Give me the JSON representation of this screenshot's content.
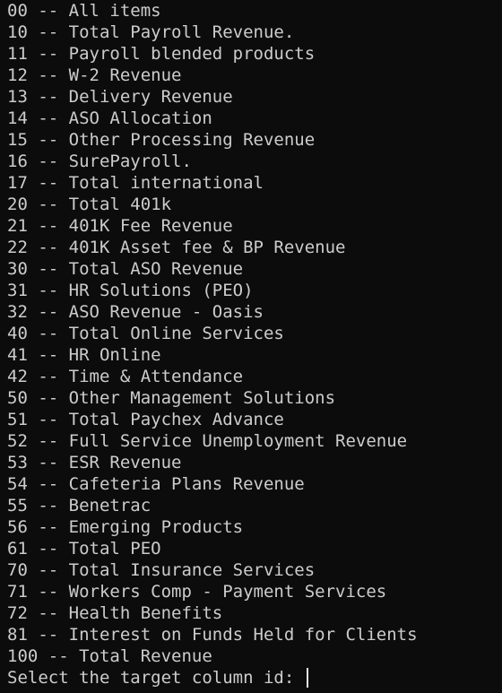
{
  "lines": [
    "00 -- All items",
    "10 -- Total Payroll Revenue.",
    "11 -- Payroll blended products",
    "12 -- W-2 Revenue",
    "13 -- Delivery Revenue",
    "14 -- ASO Allocation",
    "15 -- Other Processing Revenue",
    "16 -- SurePayroll.",
    "17 -- Total international",
    "20 -- Total 401k",
    "21 -- 401K Fee Revenue",
    "22 -- 401K Asset fee & BP Revenue",
    "30 -- Total ASO Revenue",
    "31 -- HR Solutions (PEO)",
    "32 -- ASO Revenue - Oasis",
    "40 -- Total Online Services",
    "41 -- HR Online",
    "42 -- Time & Attendance",
    "50 -- Other Management Solutions",
    "51 -- Total Paychex Advance",
    "52 -- Full Service Unemployment Revenue",
    "53 -- ESR Revenue",
    "54 -- Cafeteria Plans Revenue",
    "55 -- Benetrac",
    "56 -- Emerging Products",
    "61 -- Total PEO",
    "70 -- Total Insurance Services",
    "71 -- Workers Comp - Payment Services",
    "72 -- Health Benefits",
    "81 -- Interest on Funds Held for Clients",
    "100 -- Total Revenue"
  ],
  "prompt": "Select the target column id: "
}
